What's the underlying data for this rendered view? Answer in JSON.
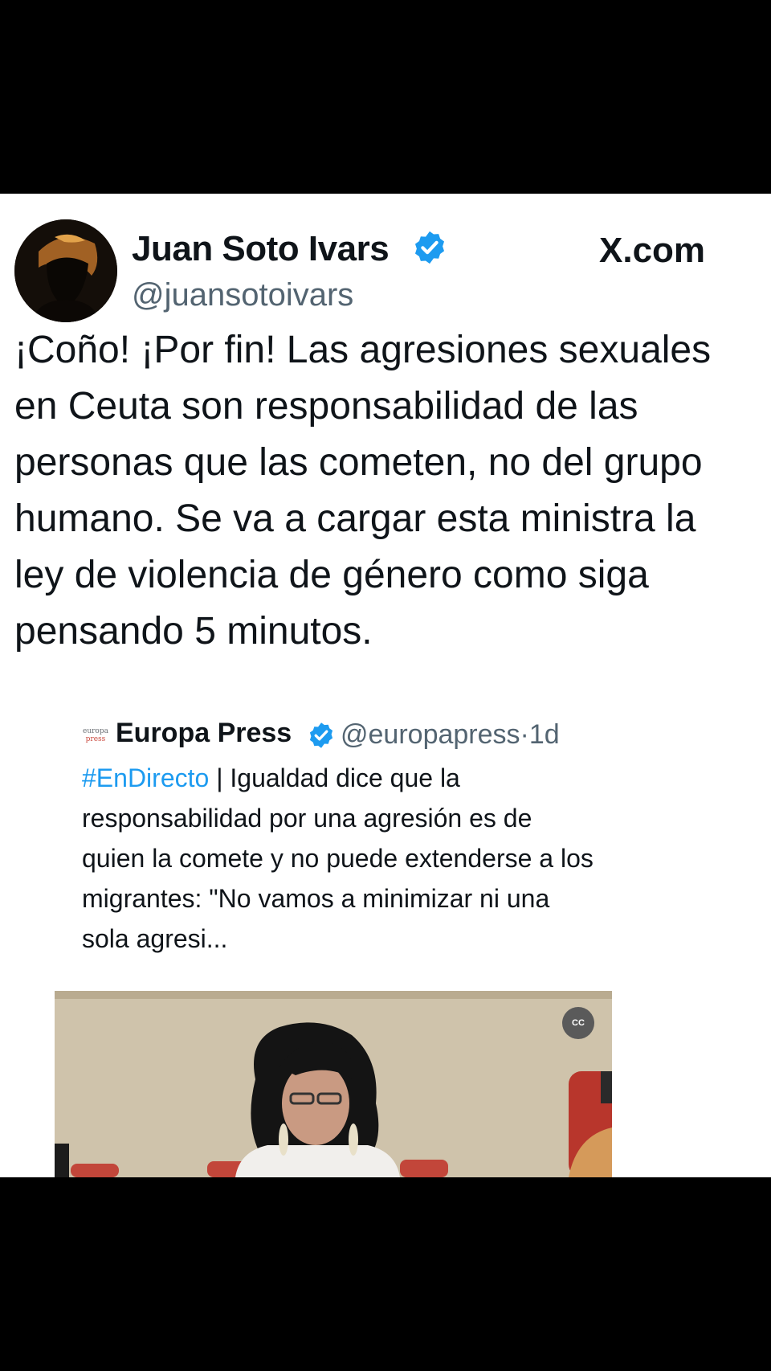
{
  "tweet": {
    "display_name": "Juan Soto Ivars",
    "handle": "@juansotoivars",
    "site": "X.com",
    "text": "¡Coño! ¡Por fin! Las agresiones sexuales en Ceuta son responsabilidad de las personas que las cometen, no del grupo humano. Se va a cargar esta ministra la ley de violencia de género como siga pensando 5 minutos."
  },
  "quote": {
    "logo_text_top": "europa",
    "logo_text_bottom": "press",
    "name": "Europa Press",
    "handle": "@europapress",
    "time": "1d",
    "hashtag": "#EnDirecto",
    "text": " | Igualdad dice que la responsabilidad por una agresión es de quien la comete y no puede extenderse a los migrantes: \"No vamos a minimizar ni una sola agresi...",
    "media_button": "CC"
  },
  "colors": {
    "verified": "#1d9bf0",
    "hashtag": "#1d9bf0",
    "text": "#0f1419",
    "secondary": "#536471"
  }
}
